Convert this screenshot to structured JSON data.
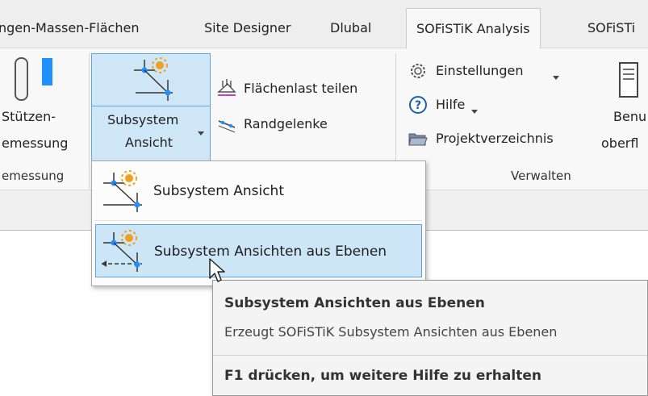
{
  "tabs": [
    {
      "label": "ngen-Massen-Flächen",
      "active": false
    },
    {
      "label": "Site Designer",
      "active": false
    },
    {
      "label": "Dlubal",
      "active": false
    },
    {
      "label": "SOFiSTiK Analysis",
      "active": true
    },
    {
      "label": "SOFiSTi",
      "active": false
    }
  ],
  "ribbon": {
    "stuetzen": {
      "line1": "Stützen-",
      "line2": "emessung"
    },
    "group_left": "emessung",
    "subsystem": {
      "line1": "Subsystem",
      "line2": "Ansicht"
    },
    "flaechenlast": "Flächenlast teilen",
    "randgelenke": "Randgelenke",
    "einstellungen": "Einstellungen",
    "hilfe": "Hilfe",
    "projektverzeichnis": "Projektverzeichnis",
    "group_verwalten": "Verwalten",
    "benu": {
      "line1": "Benu",
      "line2": "oberfl"
    }
  },
  "dropdown": {
    "items": [
      {
        "label": "Subsystem  Ansicht",
        "highlighted": false
      },
      {
        "label": "Subsystem Ansichten aus Ebenen",
        "highlighted": true
      }
    ]
  },
  "tooltip": {
    "title": "Subsystem Ansichten aus Ebenen",
    "description": "Erzeugt SOFiSTiK Subsystem Ansichten aus Ebenen",
    "help": "F1 drücken, um weitere Hilfe zu erhalten"
  },
  "colors": {
    "highlight_bg": "#cce6f8",
    "highlight_border": "#59a5db",
    "accent_blue": "#1e90ff",
    "accent_orange": "#f0a020"
  }
}
